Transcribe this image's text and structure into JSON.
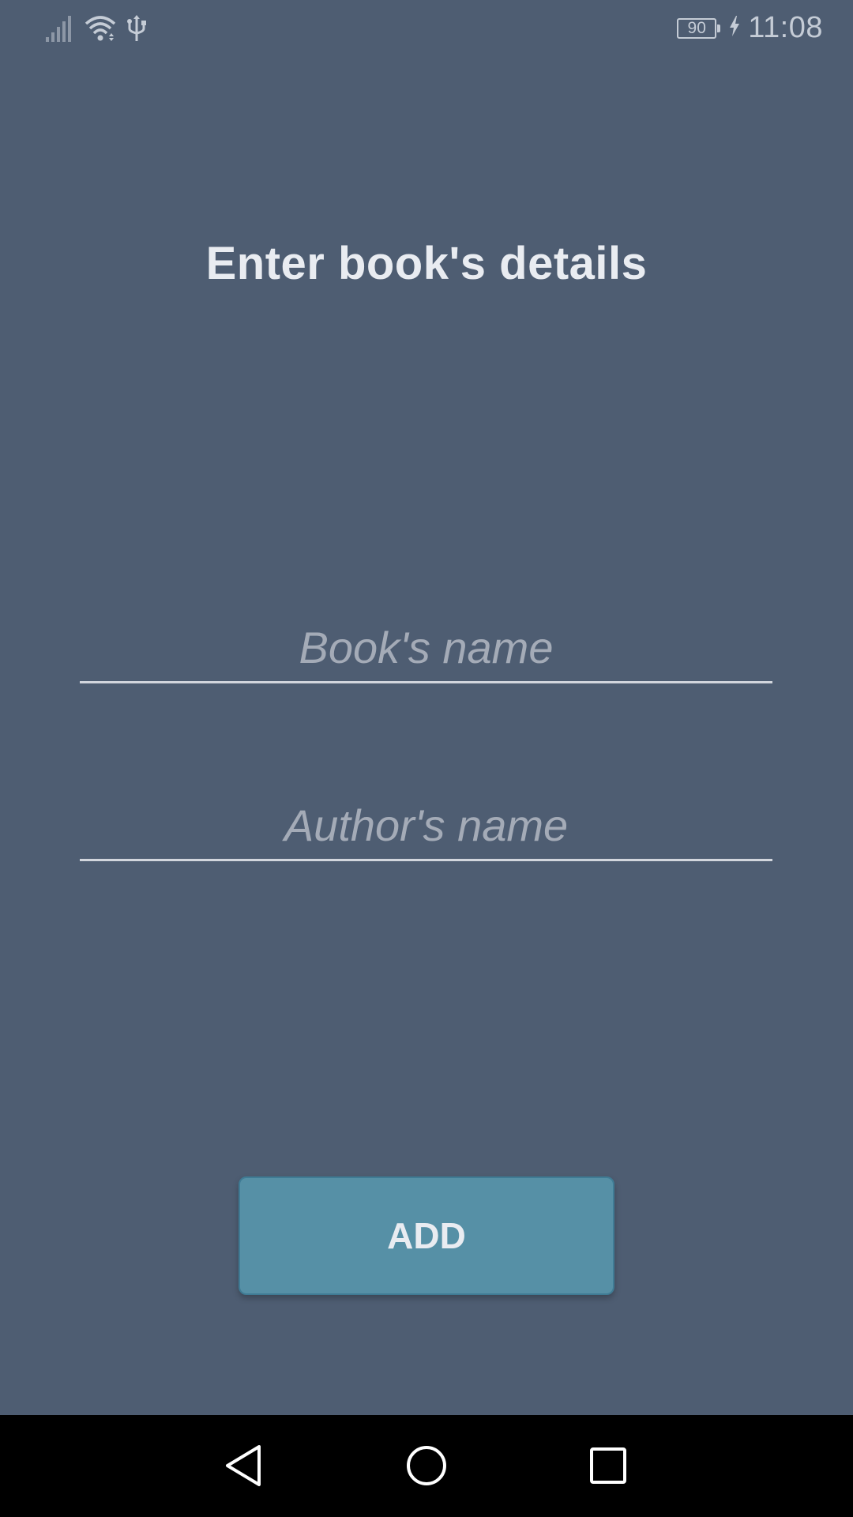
{
  "status_bar": {
    "battery_level": "90",
    "time": "11:08",
    "icons": [
      "signal-icon",
      "wifi-icon",
      "usb-icon",
      "battery-icon",
      "charging-icon"
    ]
  },
  "form": {
    "title": "Enter book's details",
    "book_name_placeholder": "Book's name",
    "book_name_value": "",
    "author_name_placeholder": "Author's name",
    "author_name_value": "",
    "add_label": "ADD"
  },
  "nav_bar": {
    "icons": [
      "back-icon",
      "home-icon",
      "recent-apps-icon"
    ]
  },
  "colors": {
    "background": "#4e5d72",
    "button": "#5690a6",
    "text": "#e9ecf1",
    "placeholder": "#a4abb7",
    "nav_background": "#000000"
  }
}
